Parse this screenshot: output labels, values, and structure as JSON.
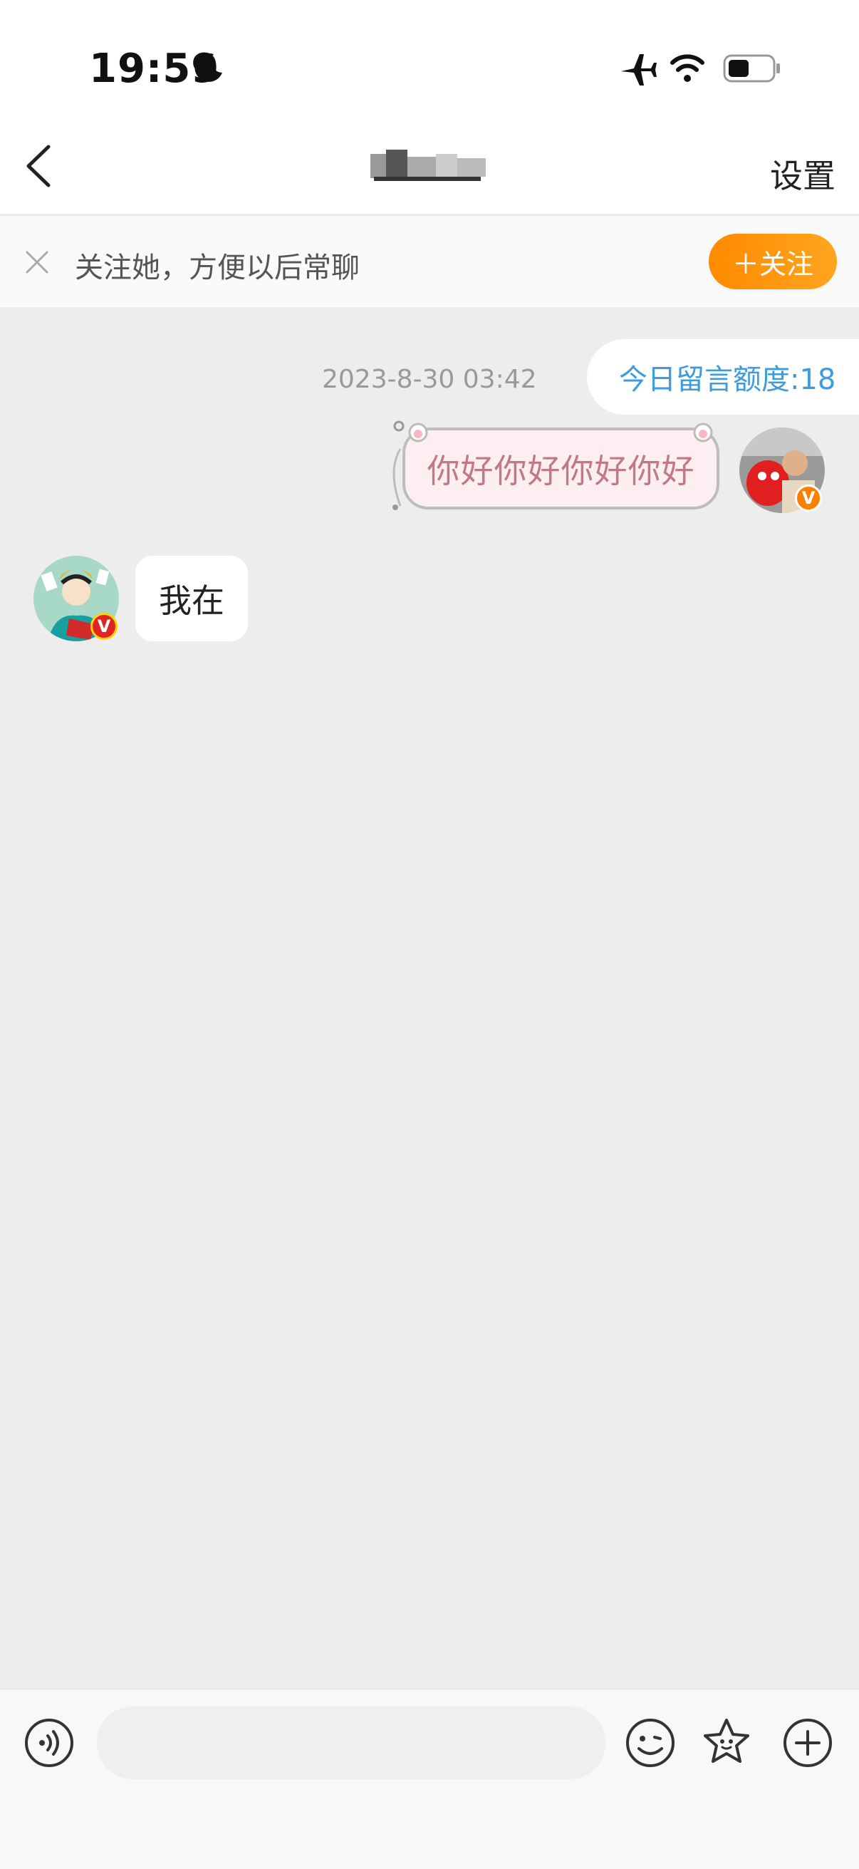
{
  "status_bar": {
    "time": "19:59"
  },
  "nav": {
    "title": "",
    "settings_label": "设置"
  },
  "banner": {
    "text": "关注她，方便以后常聊",
    "follow_label": "＋关注"
  },
  "chat": {
    "timestamp": "2023-8-30 03:42",
    "quota_label": "今日留言额度:18",
    "messages": [
      {
        "from": "me",
        "text": "你好你好你好你好"
      },
      {
        "from": "other",
        "text": "我在"
      }
    ],
    "badge_letter": "V"
  },
  "input": {
    "placeholder": ""
  },
  "icons": [
    "moon-icon",
    "airplane-icon",
    "wifi-icon",
    "battery-icon",
    "back-icon",
    "close-icon",
    "voice-icon",
    "emoji-icon",
    "sticker-icon",
    "add-icon"
  ],
  "colors": {
    "accent": "#ff8a00",
    "quota_blue": "#3d9be0",
    "bubble_pink": "#fdeff1"
  }
}
